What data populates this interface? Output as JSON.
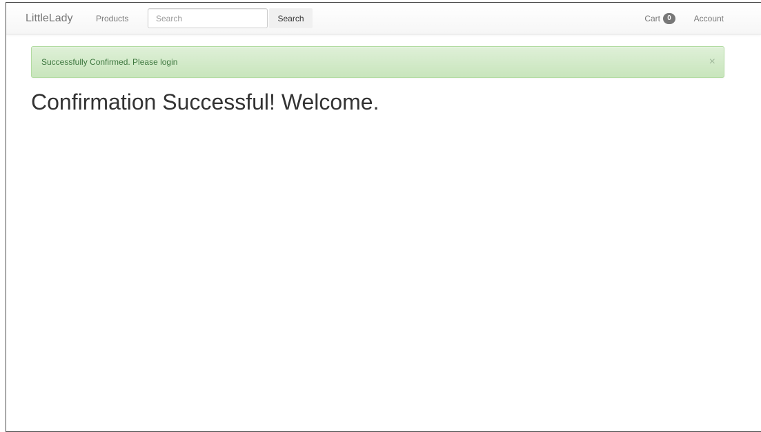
{
  "navbar": {
    "brand": "LittleLady",
    "products_label": "Products",
    "search_placeholder": "Search",
    "search_button_label": "Search",
    "cart_label": "Cart",
    "cart_count": "0",
    "account_label": "Account"
  },
  "alert": {
    "message": "Successfully Confirmed. Please login",
    "close_symbol": "×",
    "color": "#3c763d"
  },
  "main": {
    "title": "Confirmation Successful! Welcome."
  }
}
